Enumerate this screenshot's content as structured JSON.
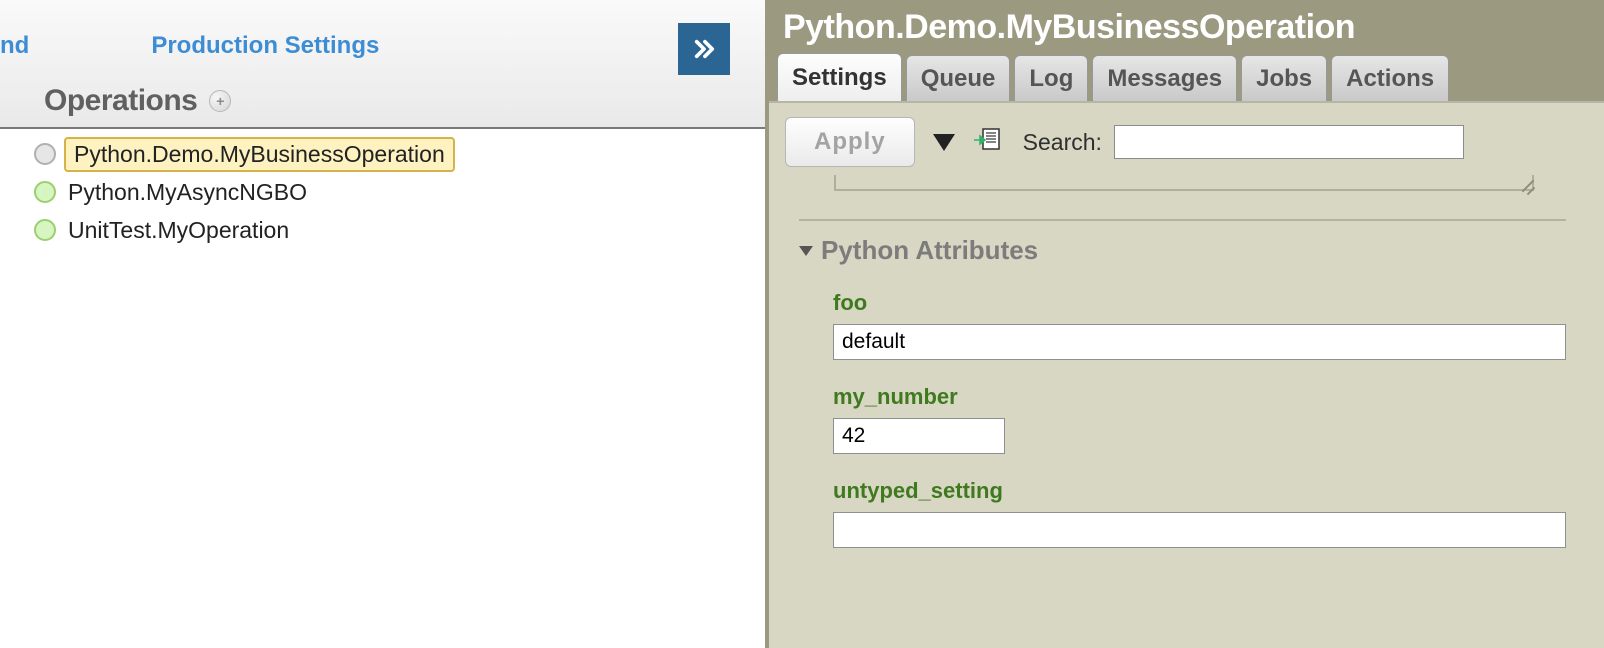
{
  "nav": {
    "fragment": "nd",
    "production_settings": "Production Settings"
  },
  "operations": {
    "heading": "Operations",
    "add_symbol": "+",
    "items": [
      {
        "label": "Python.Demo.MyBusinessOperation",
        "status": "grey",
        "selected": true
      },
      {
        "label": "Python.MyAsyncNGBO",
        "status": "green",
        "selected": false
      },
      {
        "label": "UnitTest.MyOperation",
        "status": "green",
        "selected": false
      }
    ]
  },
  "right": {
    "title": "Python.Demo.MyBusinessOperation",
    "tabs": [
      {
        "label": "Settings",
        "active": true
      },
      {
        "label": "Queue",
        "active": false
      },
      {
        "label": "Log",
        "active": false
      },
      {
        "label": "Messages",
        "active": false
      },
      {
        "label": "Jobs",
        "active": false
      },
      {
        "label": "Actions",
        "active": false
      }
    ],
    "apply": "Apply",
    "search_label": "Search:",
    "search_value": "",
    "section": {
      "title": "Python Attributes",
      "fields": [
        {
          "label": "foo",
          "value": "default",
          "width": "wide"
        },
        {
          "label": "my_number",
          "value": "42",
          "width": "narrow"
        },
        {
          "label": "untyped_setting",
          "value": "",
          "width": "wide"
        }
      ]
    }
  }
}
